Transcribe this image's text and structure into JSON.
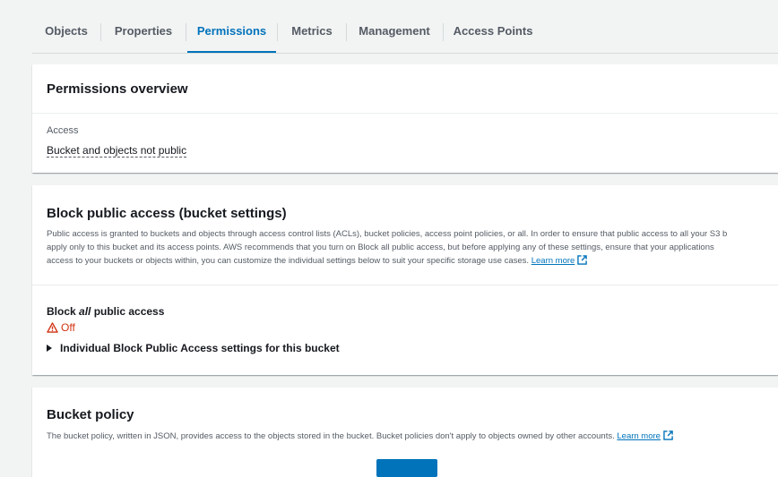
{
  "tabs": [
    {
      "label": "Objects"
    },
    {
      "label": "Properties"
    },
    {
      "label": "Permissions"
    },
    {
      "label": "Metrics"
    },
    {
      "label": "Management"
    },
    {
      "label": "Access Points"
    }
  ],
  "active_tab": "Permissions",
  "permissions_overview": {
    "title": "Permissions overview",
    "access_label": "Access",
    "access_value": "Bucket and objects not public"
  },
  "block_public_access": {
    "title": "Block public access (bucket settings)",
    "description_lines": [
      "Public access is granted to buckets and objects through access control lists (ACLs), bucket policies, access point policies, or all. In order to ensure that public access to all your S3 b",
      "apply only to this bucket and its access points. AWS recommends that you turn on Block all public access, but before applying any of these settings, ensure that your applications",
      "access to your buckets or objects within, you can customize the individual settings below to suit your specific storage use cases."
    ],
    "learn_more": "Learn more",
    "block_all_prefix": "Block ",
    "block_all_emphasis": "all",
    "block_all_suffix": " public access",
    "status": "Off",
    "status_icon": "warning-icon",
    "status_color": "#d13212",
    "expander_label": "Individual Block Public Access settings for this bucket"
  },
  "bucket_policy": {
    "title": "Bucket policy",
    "description": "The bucket policy, written in JSON, provides access to the objects stored in the bucket. Bucket policies don't apply to objects owned by other accounts.",
    "learn_more": "Learn more"
  },
  "colors": {
    "accent": "#0073bb",
    "background": "#f2f3f3",
    "panel": "#ffffff",
    "warning": "#d13212"
  }
}
